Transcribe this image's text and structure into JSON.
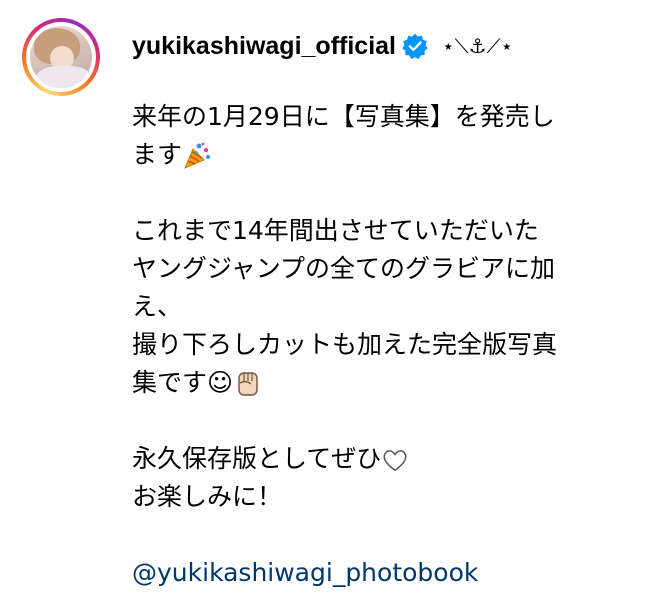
{
  "post": {
    "username": "yukikashiwagi_official",
    "decoration": "⋆⟍⚓︎⟋⋆",
    "caption_lines": [
      "来年の1月29日に【写真集】を発売し",
      "ます",
      "",
      "これまで14年間出させていただいた",
      "ヤングジャンプの全てのグラビアに加",
      "え、",
      "撮り下ろしカットも加えた完全版写真",
      "集です☺",
      "",
      "永久保存版としてぜひ",
      "お楽しみに！",
      "",
      "@yukikashiwagi_photobook"
    ],
    "mention": "@yukikashiwagi_photobook"
  },
  "icons": {
    "verified": "verified-badge-icon",
    "confetti": "party-popper-emoji",
    "fist": "raised-fist-emoji",
    "heart": "white-heart-emoji"
  },
  "colors": {
    "verified_blue": "#0095f6",
    "mention_blue": "#00376b",
    "text": "#000000"
  }
}
